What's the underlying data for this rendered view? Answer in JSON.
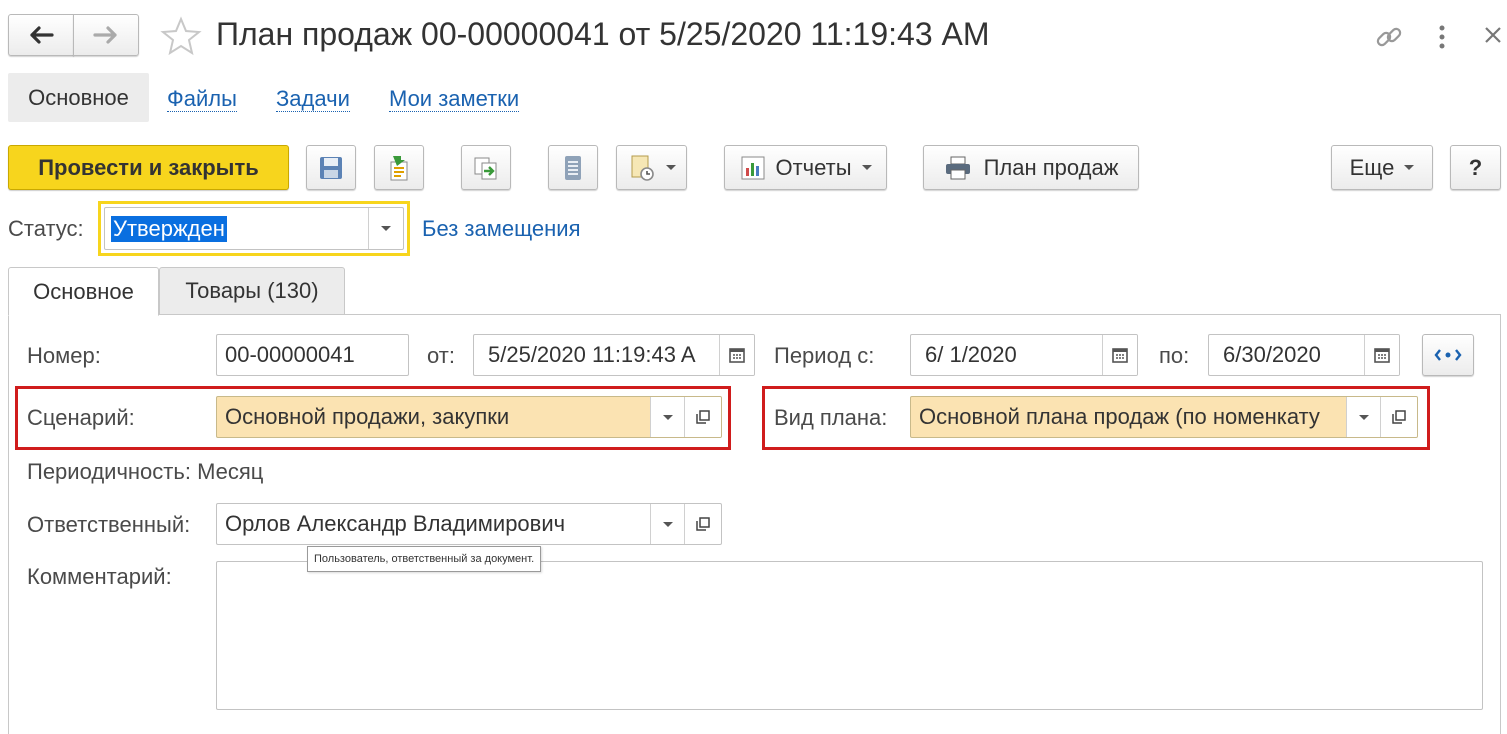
{
  "window": {
    "title": "План продаж 00-00000041 от 5/25/2020 11:19:43 AM"
  },
  "nav_tabs": [
    {
      "label": "Основное"
    },
    {
      "label": "Файлы"
    },
    {
      "label": "Задачи"
    },
    {
      "label": "Мои заметки"
    }
  ],
  "toolbar": {
    "post_close_label": "Провести и закрыть",
    "reports_label": "Отчеты",
    "print_label": "План продаж",
    "more_label": "Еще",
    "help_label": "?"
  },
  "status": {
    "label": "Статус:",
    "value": "Утвержден",
    "link": "Без замещения"
  },
  "form_tabs": [
    {
      "label": "Основное"
    },
    {
      "label": "Товары (130)"
    }
  ],
  "form": {
    "number_label": "Номер:",
    "number_value": "00-00000041",
    "date_label": "от:",
    "date_value": "5/25/2020 11:19:43 A",
    "period_label": "Период с:",
    "period_from": "6/ 1/2020",
    "period_to_label": "по:",
    "period_to": "6/30/2020",
    "scenario_label": "Сценарий:",
    "scenario_value": "Основной продажи, закупки",
    "plan_type_label": "Вид плана:",
    "plan_type_value": "Основной плана продаж (по номенкату",
    "periodicity_label": "Периодичность:",
    "periodicity_value": "Месяц",
    "responsible_label": "Ответственный:",
    "responsible_value": "Орлов Александр Владимирович",
    "tooltip": "Пользователь, ответственный за документ.",
    "comment_label": "Комментарий:",
    "comment_value": ""
  },
  "colors": {
    "accent_yellow": "#f7d51d",
    "link_blue": "#1a62b0",
    "required_fill": "#fbe3b2",
    "highlight_red": "#d01c1c",
    "selection_blue": "#0a6fe0"
  }
}
